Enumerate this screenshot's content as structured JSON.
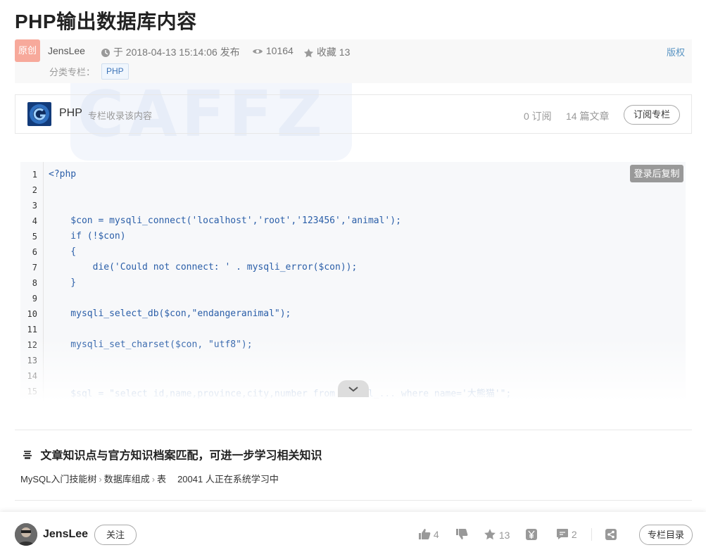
{
  "article": {
    "title": "PHP输出数据库内容",
    "badge": "原创",
    "author": "JensLee",
    "published": "于 2018-04-13 15:14:06 发布",
    "views": "10164",
    "favorites_label": "收藏 13",
    "copyright": "版权",
    "category_label": "分类专栏：",
    "category_tag": "PHP"
  },
  "column": {
    "name": "PHP",
    "desc": "专栏收录该内容",
    "subs": "0 订阅",
    "articles": "14 篇文章",
    "subscribe_btn": "订阅专栏"
  },
  "code": {
    "copy_btn": "登录后复制",
    "lines": [
      {
        "n": "1",
        "t": "<?php"
      },
      {
        "n": "2",
        "t": ""
      },
      {
        "n": "3",
        "t": ""
      },
      {
        "n": "4",
        "t": "    $con = mysqli_connect('localhost','root','123456','animal');"
      },
      {
        "n": "5",
        "t": "    if (!$con)"
      },
      {
        "n": "6",
        "t": "    {"
      },
      {
        "n": "7",
        "t": "        die('Could not connect: ' . mysqli_error($con));"
      },
      {
        "n": "8",
        "t": "    }"
      },
      {
        "n": "9",
        "t": ""
      },
      {
        "n": "10",
        "t": "    mysqli_select_db($con,\"endangeranimal\");"
      },
      {
        "n": "11",
        "t": ""
      },
      {
        "n": "12",
        "t": "    mysqli_set_charset($con, \"utf8\");"
      },
      {
        "n": "13",
        "t": ""
      },
      {
        "n": "14",
        "t": ""
      },
      {
        "n": "15",
        "t": "    $sql = \"select id,name,province,city,number from animal_... where name='大熊猫'\";"
      }
    ]
  },
  "knowledge": {
    "title": "文章知识点与官方知识档案匹配，可进一步学习相关知识",
    "path1": "MySQL入门技能树",
    "path2": "数据库组成",
    "path3": "表",
    "learners": "20041 人正在系统学习中"
  },
  "footer": {
    "author": "JensLee",
    "follow_btn": "关注",
    "likes": "4",
    "favorites": "13",
    "comments": "2",
    "toc_btn": "专栏目录"
  }
}
